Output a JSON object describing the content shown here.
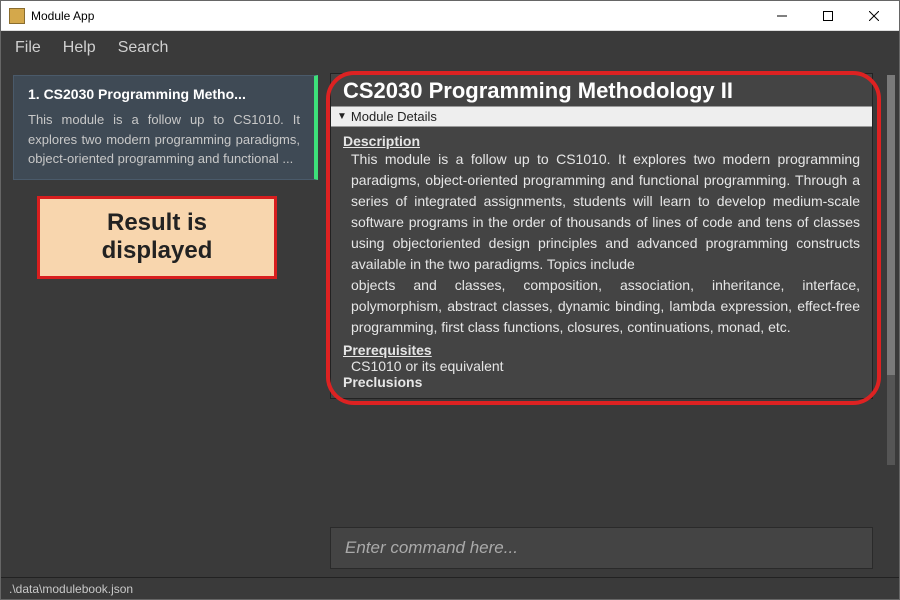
{
  "window": {
    "title": "Module App"
  },
  "menu": {
    "file": "File",
    "help": "Help",
    "search": "Search"
  },
  "sidebar": {
    "items": [
      {
        "index_label": "1.  CS2030 Programming Metho...",
        "snippet": "This module is a follow up to CS1010. It explores two modern programming paradigms, object-oriented programming and functional ..."
      }
    ]
  },
  "callout": {
    "text": "Result is displayed"
  },
  "detail": {
    "title": "CS2030 Programming Methodology II",
    "panel_label": "Module Details",
    "sections": {
      "description_label": "Description",
      "description_p1": "This module is a follow up to CS1010. It explores two modern programming paradigms, object-oriented programming and functional programming. Through a series of integrated assignments, students will learn to develop medium-scale software programs in the order of thousands of lines of code and tens of classes using objectoriented design principles and advanced programming constructs available in the two paradigms. Topics include",
      "description_p2": "objects and classes, composition, association, inheritance, interface, polymorphism, abstract classes, dynamic binding, lambda expression, effect-free programming, first class functions, closures, continuations, monad, etc.",
      "prereq_label": "Prerequisites",
      "prereq_value": "CS1010 or its equivalent",
      "preclusion_label": "Preclusions"
    }
  },
  "command": {
    "placeholder": "Enter command here..."
  },
  "status": {
    "path": ".\\data\\modulebook.json"
  }
}
